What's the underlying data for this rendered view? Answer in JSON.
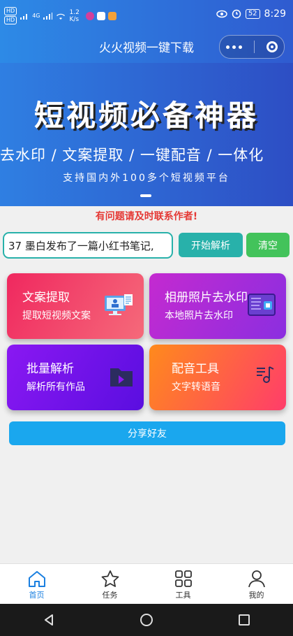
{
  "status_bar": {
    "sim1": "HD",
    "sim2": "HD",
    "network": "4G",
    "speed": "1.2 K/s",
    "battery": "52",
    "time": "8:29"
  },
  "titlebar": {
    "title": "火火视频一键下载"
  },
  "banner": {
    "title": "短视频必备神器",
    "subtitle": "去水印 / 文案提取 / 一键配音 /  一体化",
    "note": "支持国内外100多个短视频平台"
  },
  "contact_note": "有问题请及时联系作者!",
  "search": {
    "value": "37 墨白发布了一篇小红书笔记,",
    "parse_label": "开始解析",
    "clear_label": "清空"
  },
  "cards": [
    {
      "title": "文案提取",
      "subtitle": "提取短视频文案",
      "icon": "document-monitor-icon",
      "color": "#f0285f"
    },
    {
      "title": "相册照片去水印",
      "subtitle": "本地照片去水印",
      "icon": "image-frame-icon",
      "color": "#c42ad0"
    },
    {
      "title": "批量解析",
      "subtitle": "解析所有作品",
      "icon": "folder-icon",
      "color": "#8a18f2"
    },
    {
      "title": "配音工具",
      "subtitle": "文字转语音",
      "icon": "music-list-icon",
      "color": "#ff8a1c"
    }
  ],
  "share_label": "分享好友",
  "tabs": [
    {
      "label": "首页",
      "icon": "home-icon",
      "active": true
    },
    {
      "label": "任务",
      "icon": "star-icon"
    },
    {
      "label": "工具",
      "icon": "grid-icon"
    },
    {
      "label": "我的",
      "icon": "user-icon"
    }
  ],
  "colors": {
    "accent": "#28b1aa",
    "tab_active": "#1a7fe0",
    "banner": "#2f5bd0"
  }
}
